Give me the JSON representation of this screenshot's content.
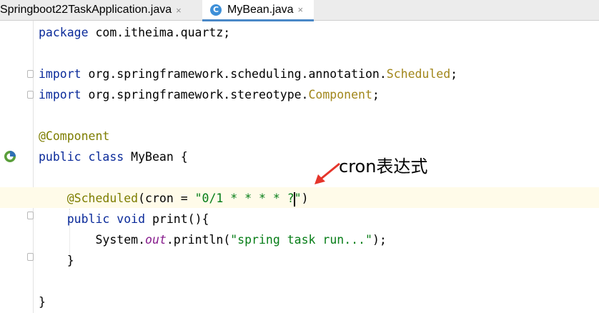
{
  "tabs": [
    {
      "label": "Springboot22TaskApplication.java",
      "close": "×",
      "active": false
    },
    {
      "label": "MyBean.java",
      "close": "×",
      "active": true,
      "icon_letter": "C"
    }
  ],
  "code": {
    "l1": {
      "kw": "package",
      "rest": " com.itheima.quartz;"
    },
    "l3": {
      "kw": "import",
      "pkg": " org.springframework.scheduling.annotation.",
      "cls": "Scheduled",
      "end": ";"
    },
    "l4": {
      "kw": "import",
      "pkg": " org.springframework.stereotype.",
      "cls": "Component",
      "end": ";"
    },
    "l6": {
      "ann": "@Component"
    },
    "l7": {
      "kw": "public class",
      "rest": " MyBean {"
    },
    "l9": {
      "indent": "    ",
      "ann": "@Scheduled",
      "p1": "(cron = ",
      "str1": "\"0/1 * * * * ?",
      "str2": "\"",
      "p2": ")"
    },
    "l10": {
      "indent": "    ",
      "kw": "public void",
      "rest": " print(){"
    },
    "l11": {
      "indent": "        ",
      "pre": "System.",
      "field": "out",
      "post": ".println(",
      "str": "\"spring task run...\"",
      "end": ");"
    },
    "l12": {
      "text": "    }"
    },
    "l14": {
      "text": "}"
    }
  },
  "annotation": {
    "text": "cron表达式",
    "color": "#e5352b"
  }
}
